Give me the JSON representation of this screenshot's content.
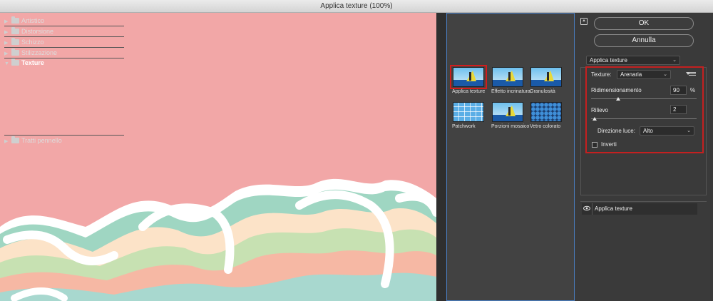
{
  "window": {
    "title": "Applica texture (100%)"
  },
  "gallery": {
    "categories": [
      {
        "label": "Artistico",
        "expanded": false
      },
      {
        "label": "Distorsione",
        "expanded": false
      },
      {
        "label": "Schizzo",
        "expanded": false
      },
      {
        "label": "Stilizzazione",
        "expanded": false
      },
      {
        "label": "Texture",
        "expanded": true
      },
      {
        "label": "Tratti pennello",
        "expanded": false
      }
    ],
    "texture_filters": [
      {
        "label": "Applica texture",
        "selected": true
      },
      {
        "label": "Effetto incrinatura",
        "selected": false
      },
      {
        "label": "Granulosità",
        "selected": false
      },
      {
        "label": "Patchwork",
        "selected": false
      },
      {
        "label": "Porzioni mosaico",
        "selected": false
      },
      {
        "label": "Vetro colorato",
        "selected": false
      }
    ]
  },
  "actions": {
    "ok": "OK",
    "cancel": "Annulla"
  },
  "settings": {
    "filter_select": "Applica texture",
    "texture_label": "Texture:",
    "texture_value": "Arenaria",
    "scaling_label": "Ridimensionamento",
    "scaling_value": "90",
    "scaling_unit": "%",
    "relief_label": "Rilievo",
    "relief_value": "2",
    "light_label": "Direzione luce:",
    "light_value": "Alto",
    "invert_label": "Inverti",
    "invert_checked": false
  },
  "layers": {
    "items": [
      {
        "label": "Applica texture",
        "visible": true
      }
    ]
  },
  "colors": {
    "canvas_bg": "#f2a7a7",
    "highlight": "#c42020",
    "gallery_border": "#4a7ec1"
  }
}
